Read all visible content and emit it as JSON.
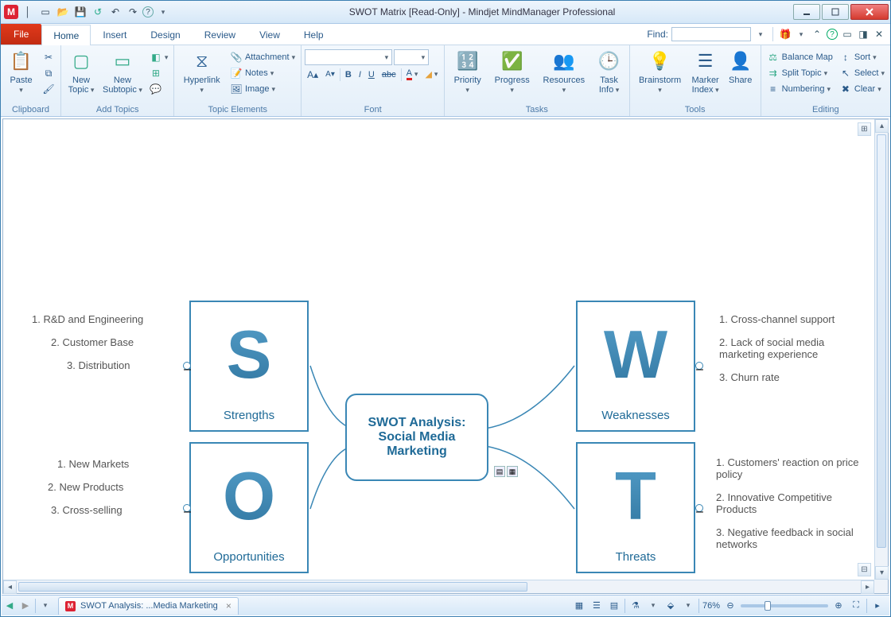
{
  "title": "SWOT Matrix [Read-Only] - Mindjet MindManager Professional",
  "qat": {
    "logo": "M"
  },
  "tabs": {
    "file": "File",
    "home": "Home",
    "insert": "Insert",
    "design": "Design",
    "review": "Review",
    "view": "View",
    "help": "Help"
  },
  "find": {
    "label": "Find:"
  },
  "ribbon": {
    "clipboard": {
      "paste": "Paste",
      "label": "Clipboard"
    },
    "addtopics": {
      "new_topic": "New\nTopic",
      "new_subtopic": "New\nSubtopic",
      "label": "Add Topics"
    },
    "topicelements": {
      "hyperlink": "Hyperlink",
      "attachment": "Attachment",
      "notes": "Notes",
      "image": "Image",
      "label": "Topic Elements"
    },
    "font": {
      "label": "Font"
    },
    "tasks": {
      "priority": "Priority",
      "progress": "Progress",
      "resources": "Resources",
      "taskinfo": "Task\nInfo",
      "label": "Tasks"
    },
    "tools": {
      "brainstorm": "Brainstorm",
      "markerindex": "Marker\nIndex",
      "share": "Share",
      "label": "Tools"
    },
    "editing": {
      "balancemap": "Balance Map",
      "splittopic": "Split Topic",
      "numbering": "Numbering",
      "sort": "Sort",
      "select": "Select",
      "clear": "Clear",
      "label": "Editing"
    }
  },
  "diagram": {
    "center": "SWOT Analysis: Social Media Marketing",
    "quads": {
      "s": {
        "letter": "S",
        "label": "Strengths"
      },
      "w": {
        "letter": "W",
        "label": "Weaknesses"
      },
      "o": {
        "letter": "O",
        "label": "Opportunities"
      },
      "t": {
        "letter": "T",
        "label": "Threats"
      }
    },
    "lists": {
      "s": [
        "1. R&D and Engineering",
        "2. Customer Base",
        "3. Distribution"
      ],
      "w": [
        "1. Cross-channel support",
        "2. Lack of social media marketing experience",
        "3. Churn rate"
      ],
      "o": [
        "1. New Markets",
        "2. New Products",
        "3. Cross-selling"
      ],
      "t": [
        "1. Customers' reaction on price policy",
        "2. Innovative Competitive Products",
        "3. Negative feedback in social networks"
      ]
    }
  },
  "status": {
    "doc_tab": "SWOT Analysis: ...Media Marketing",
    "zoom": "76%"
  }
}
